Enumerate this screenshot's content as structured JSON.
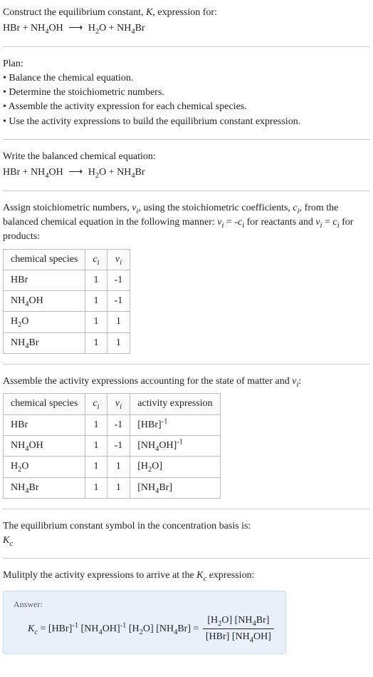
{
  "header": {
    "prompt_line1": "Construct the equilibrium constant, K, expression for:",
    "reaction_unbalanced": "HBr + NH₄OH ⟶ H₂O + NH₄Br"
  },
  "plan": {
    "title": "Plan:",
    "bullets": [
      "• Balance the chemical equation.",
      "• Determine the stoichiometric numbers.",
      "• Assemble the activity expression for each chemical species.",
      "• Use the activity expressions to build the equilibrium constant expression."
    ]
  },
  "balanced": {
    "intro": "Write the balanced chemical equation:",
    "reaction": "HBr + NH₄OH ⟶ H₂O + NH₄Br"
  },
  "stoich_assign": {
    "intro_a": "Assign stoichiometric numbers, νᵢ, using the stoichiometric coefficients, cᵢ, from the balanced chemical equation in the following manner: νᵢ = -cᵢ for reactants and νᵢ = cᵢ for products:",
    "headers": [
      "chemical species",
      "cᵢ",
      "νᵢ"
    ],
    "rows": [
      {
        "species": "HBr",
        "c": "1",
        "v": "-1"
      },
      {
        "species": "NH₄OH",
        "c": "1",
        "v": "-1"
      },
      {
        "species": "H₂O",
        "c": "1",
        "v": "1"
      },
      {
        "species": "NH₄Br",
        "c": "1",
        "v": "1"
      }
    ]
  },
  "activity": {
    "intro": "Assemble the activity expressions accounting for the state of matter and νᵢ:",
    "headers": [
      "chemical species",
      "cᵢ",
      "νᵢ",
      "activity expression"
    ],
    "rows": [
      {
        "species": "HBr",
        "c": "1",
        "v": "-1",
        "expr": "[HBr]⁻¹"
      },
      {
        "species": "NH₄OH",
        "c": "1",
        "v": "-1",
        "expr": "[NH₄OH]⁻¹"
      },
      {
        "species": "H₂O",
        "c": "1",
        "v": "1",
        "expr": "[H₂O]"
      },
      {
        "species": "NH₄Br",
        "c": "1",
        "v": "1",
        "expr": "[NH₄Br]"
      }
    ]
  },
  "basis": {
    "line1": "The equilibrium constant symbol in the concentration basis is:",
    "symbol": "K_c"
  },
  "multiply": {
    "intro": "Mulitply the activity expressions to arrive at the K_c expression:"
  },
  "answer": {
    "label": "Answer:",
    "lhs": "K_c = [HBr]⁻¹ [NH₄OH]⁻¹ [H₂O] [NH₄Br] = ",
    "frac_num": "[H₂O] [NH₄Br]",
    "frac_den": "[HBr] [NH₄OH]"
  }
}
